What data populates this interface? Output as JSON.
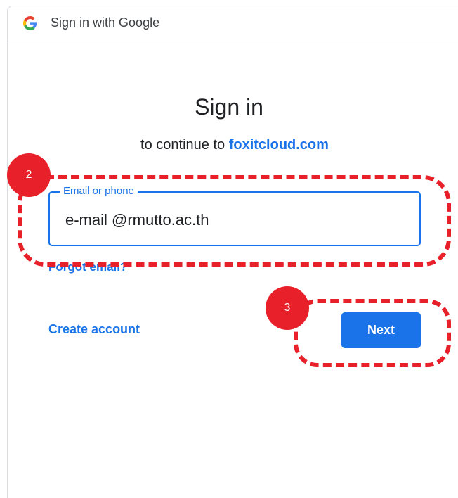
{
  "header": {
    "logo_letter": "G",
    "title": "Sign in with Google"
  },
  "main": {
    "headline": "Sign in",
    "subhead_prefix": "to continue to ",
    "subhead_site": "foxitcloud.com",
    "email_field": {
      "label": "Email or phone",
      "value": "e-mail @rmutto.ac.th"
    },
    "forgot_link": "Forgot email?",
    "create_account": "Create account",
    "next_button": "Next"
  },
  "annotations": {
    "step_email": "2",
    "step_next": "3"
  },
  "colors": {
    "accent": "#1a73e8",
    "annotation": "#e8202a",
    "text": "#202124"
  }
}
